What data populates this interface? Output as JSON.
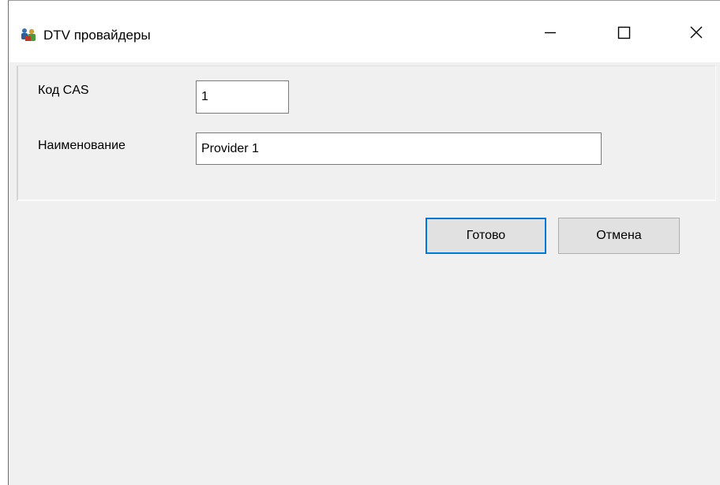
{
  "window": {
    "title": "DTV провайдеры",
    "icon": "network-users-icon"
  },
  "form": {
    "cas_code_label": "Код CAS",
    "cas_code_value": "1",
    "name_label": "Наименование",
    "name_value": "Provider 1"
  },
  "buttons": {
    "ok_label": "Готово",
    "cancel_label": "Отмена"
  },
  "colors": {
    "window_bg": "#f0f0f0",
    "titlebar_bg": "#ffffff",
    "focus_accent": "#0078d7"
  }
}
